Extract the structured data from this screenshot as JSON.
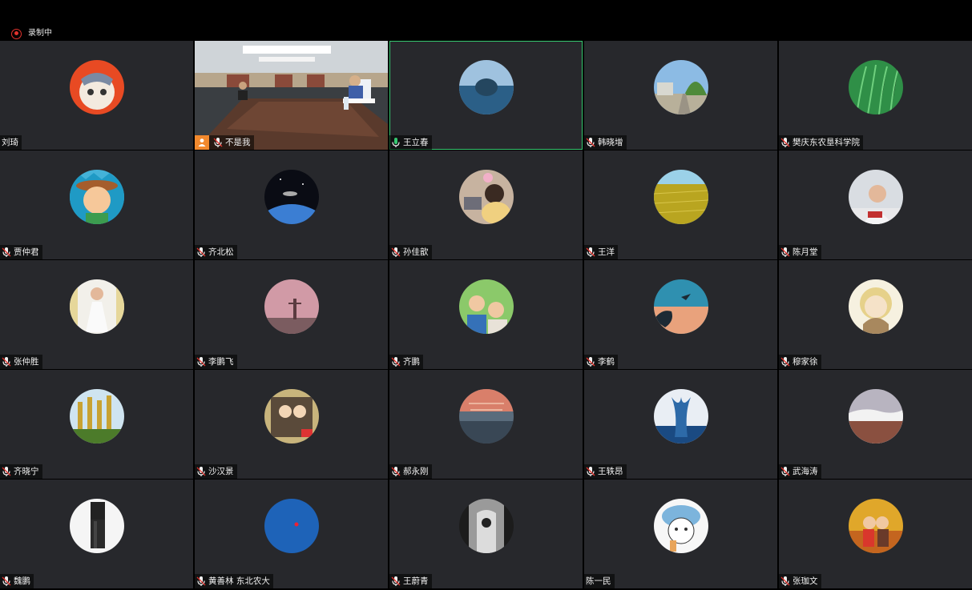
{
  "recording": {
    "label": "录制中"
  },
  "participants": [
    {
      "name": "刘琦",
      "mic": false
    },
    {
      "name": "不是我",
      "mic": true,
      "host": true,
      "video": true
    },
    {
      "name": "王立春",
      "mic": true,
      "speaking": true,
      "active": true
    },
    {
      "name": "韩晓增",
      "mic": true
    },
    {
      "name": "樊庆东农垦科学院",
      "mic": true
    },
    {
      "name": "贾仲君",
      "mic": true
    },
    {
      "name": "齐北松",
      "mic": true
    },
    {
      "name": "孙佳歆",
      "mic": true
    },
    {
      "name": "王洋",
      "mic": true
    },
    {
      "name": "陈月堂",
      "mic": true
    },
    {
      "name": "张仲胜",
      "mic": true
    },
    {
      "name": "李鹏飞",
      "mic": true
    },
    {
      "name": "齐鹏",
      "mic": true
    },
    {
      "name": "李鹤",
      "mic": true
    },
    {
      "name": "穆家徐",
      "mic": true
    },
    {
      "name": "齐晓宁",
      "mic": true
    },
    {
      "name": "沙汉景",
      "mic": true
    },
    {
      "name": "郝永刚",
      "mic": true
    },
    {
      "name": "王轶昂",
      "mic": true
    },
    {
      "name": "武海涛",
      "mic": true
    },
    {
      "name": "魏鹏",
      "mic": true
    },
    {
      "name": "黄善林 东北农大",
      "mic": true
    },
    {
      "name": "王蔚青",
      "mic": true
    },
    {
      "name": "陈一民",
      "mic": false
    },
    {
      "name": "张珈文",
      "mic": true
    }
  ],
  "colors": {
    "tile_bg": "#27282c",
    "active_border": "#36c770",
    "recording": "#e0322d",
    "host_badge": "#f2892d"
  }
}
